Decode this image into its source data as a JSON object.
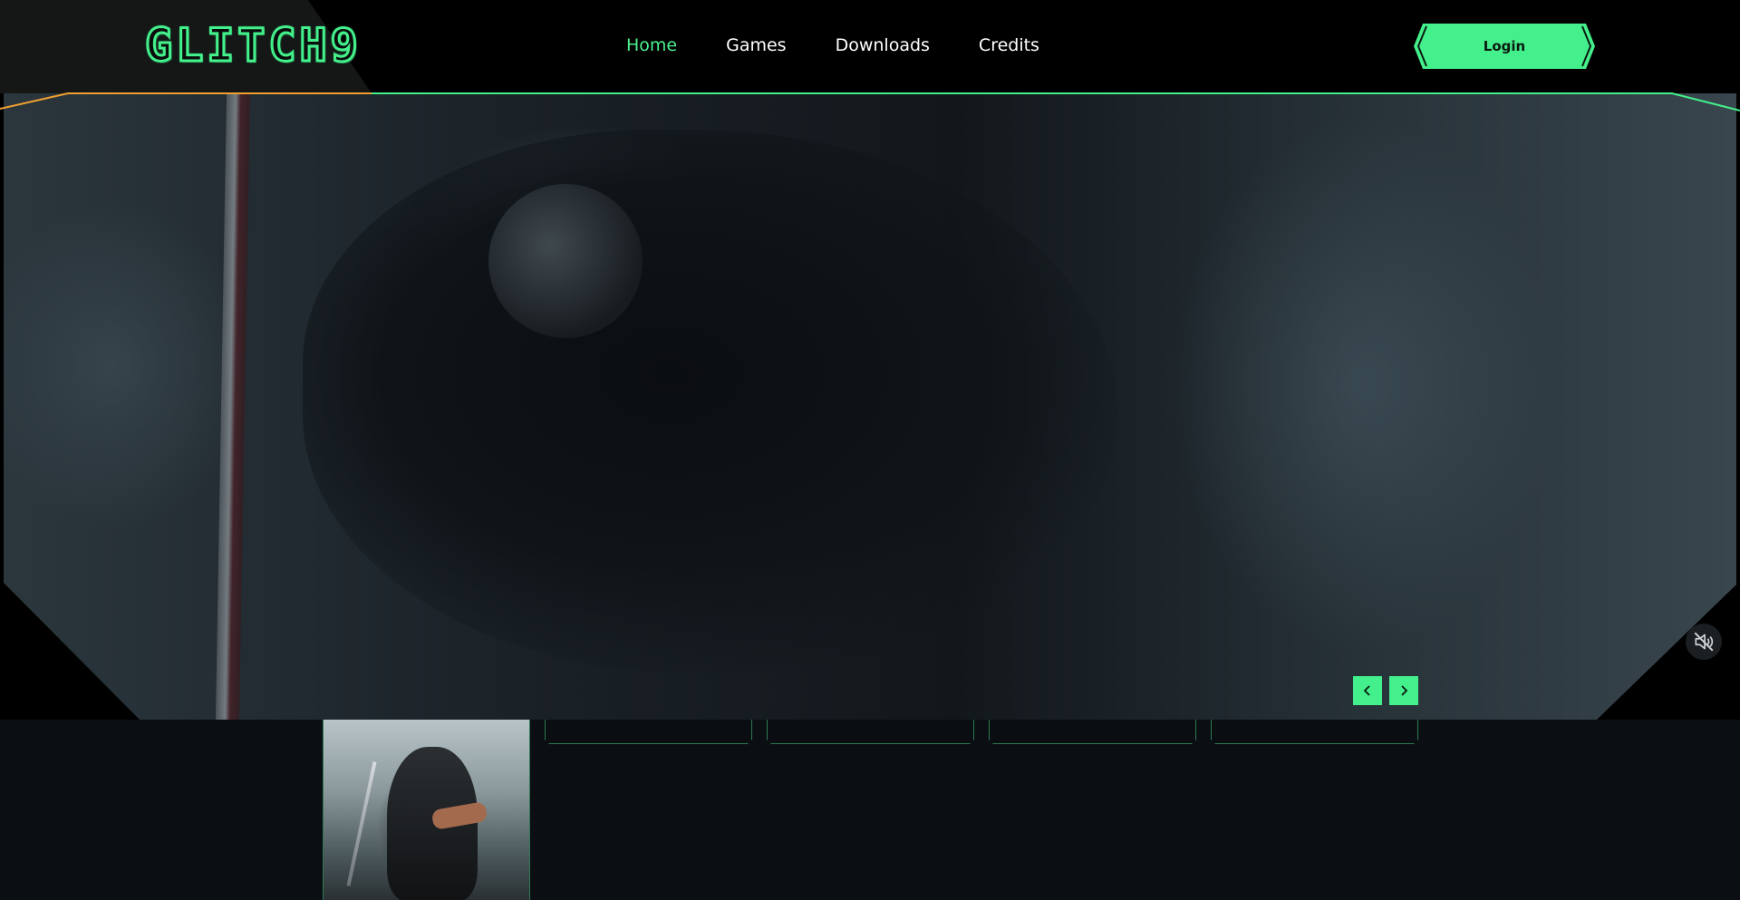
{
  "header": {
    "logo_text": "GLITCH9",
    "nav": [
      {
        "label": "Home",
        "active": true
      },
      {
        "label": "Games",
        "active": false
      },
      {
        "label": "Downloads",
        "active": false
      },
      {
        "label": "Credits",
        "active": false
      }
    ],
    "login_label": "Login"
  },
  "hero": {
    "media": "ninja-gaiden-trailer-video",
    "muted": true,
    "controls": {
      "prev_icon": "chevron-left-icon",
      "next_icon": "chevron-right-icon",
      "mute_icon": "volume-muted-icon"
    }
  },
  "carousel": {
    "selected_index": 0,
    "items": [
      {
        "type": "thumbnail",
        "image": "ninja-warrior-with-katana"
      },
      {
        "type": "empty-card"
      },
      {
        "type": "empty-card"
      },
      {
        "type": "empty-card"
      },
      {
        "type": "empty-card"
      }
    ]
  },
  "colors": {
    "accent_green": "#43f08b",
    "accent_orange": "#f0a030",
    "background": "#000000",
    "panel": "#0b0f14"
  }
}
